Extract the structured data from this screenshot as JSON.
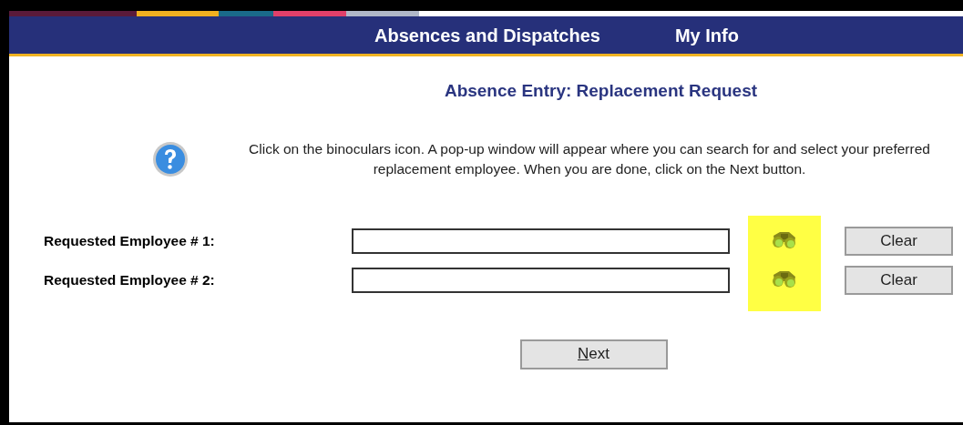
{
  "nav": {
    "items": [
      {
        "label": "Absences and Dispatches"
      },
      {
        "label": "My Info"
      }
    ]
  },
  "title": "Absence Entry: Replacement Request",
  "instructions": "Click on the binoculars icon. A pop-up window will appear where you can search for and select your preferred replacement employee. When you are done, click on the Next button.",
  "requests": [
    {
      "label": "Requested Employee # 1:",
      "clear_button": "Clear"
    },
    {
      "label": "Requested Employee # 2:",
      "clear_button": "Clear"
    }
  ],
  "next_button": {
    "label": "Next"
  }
}
